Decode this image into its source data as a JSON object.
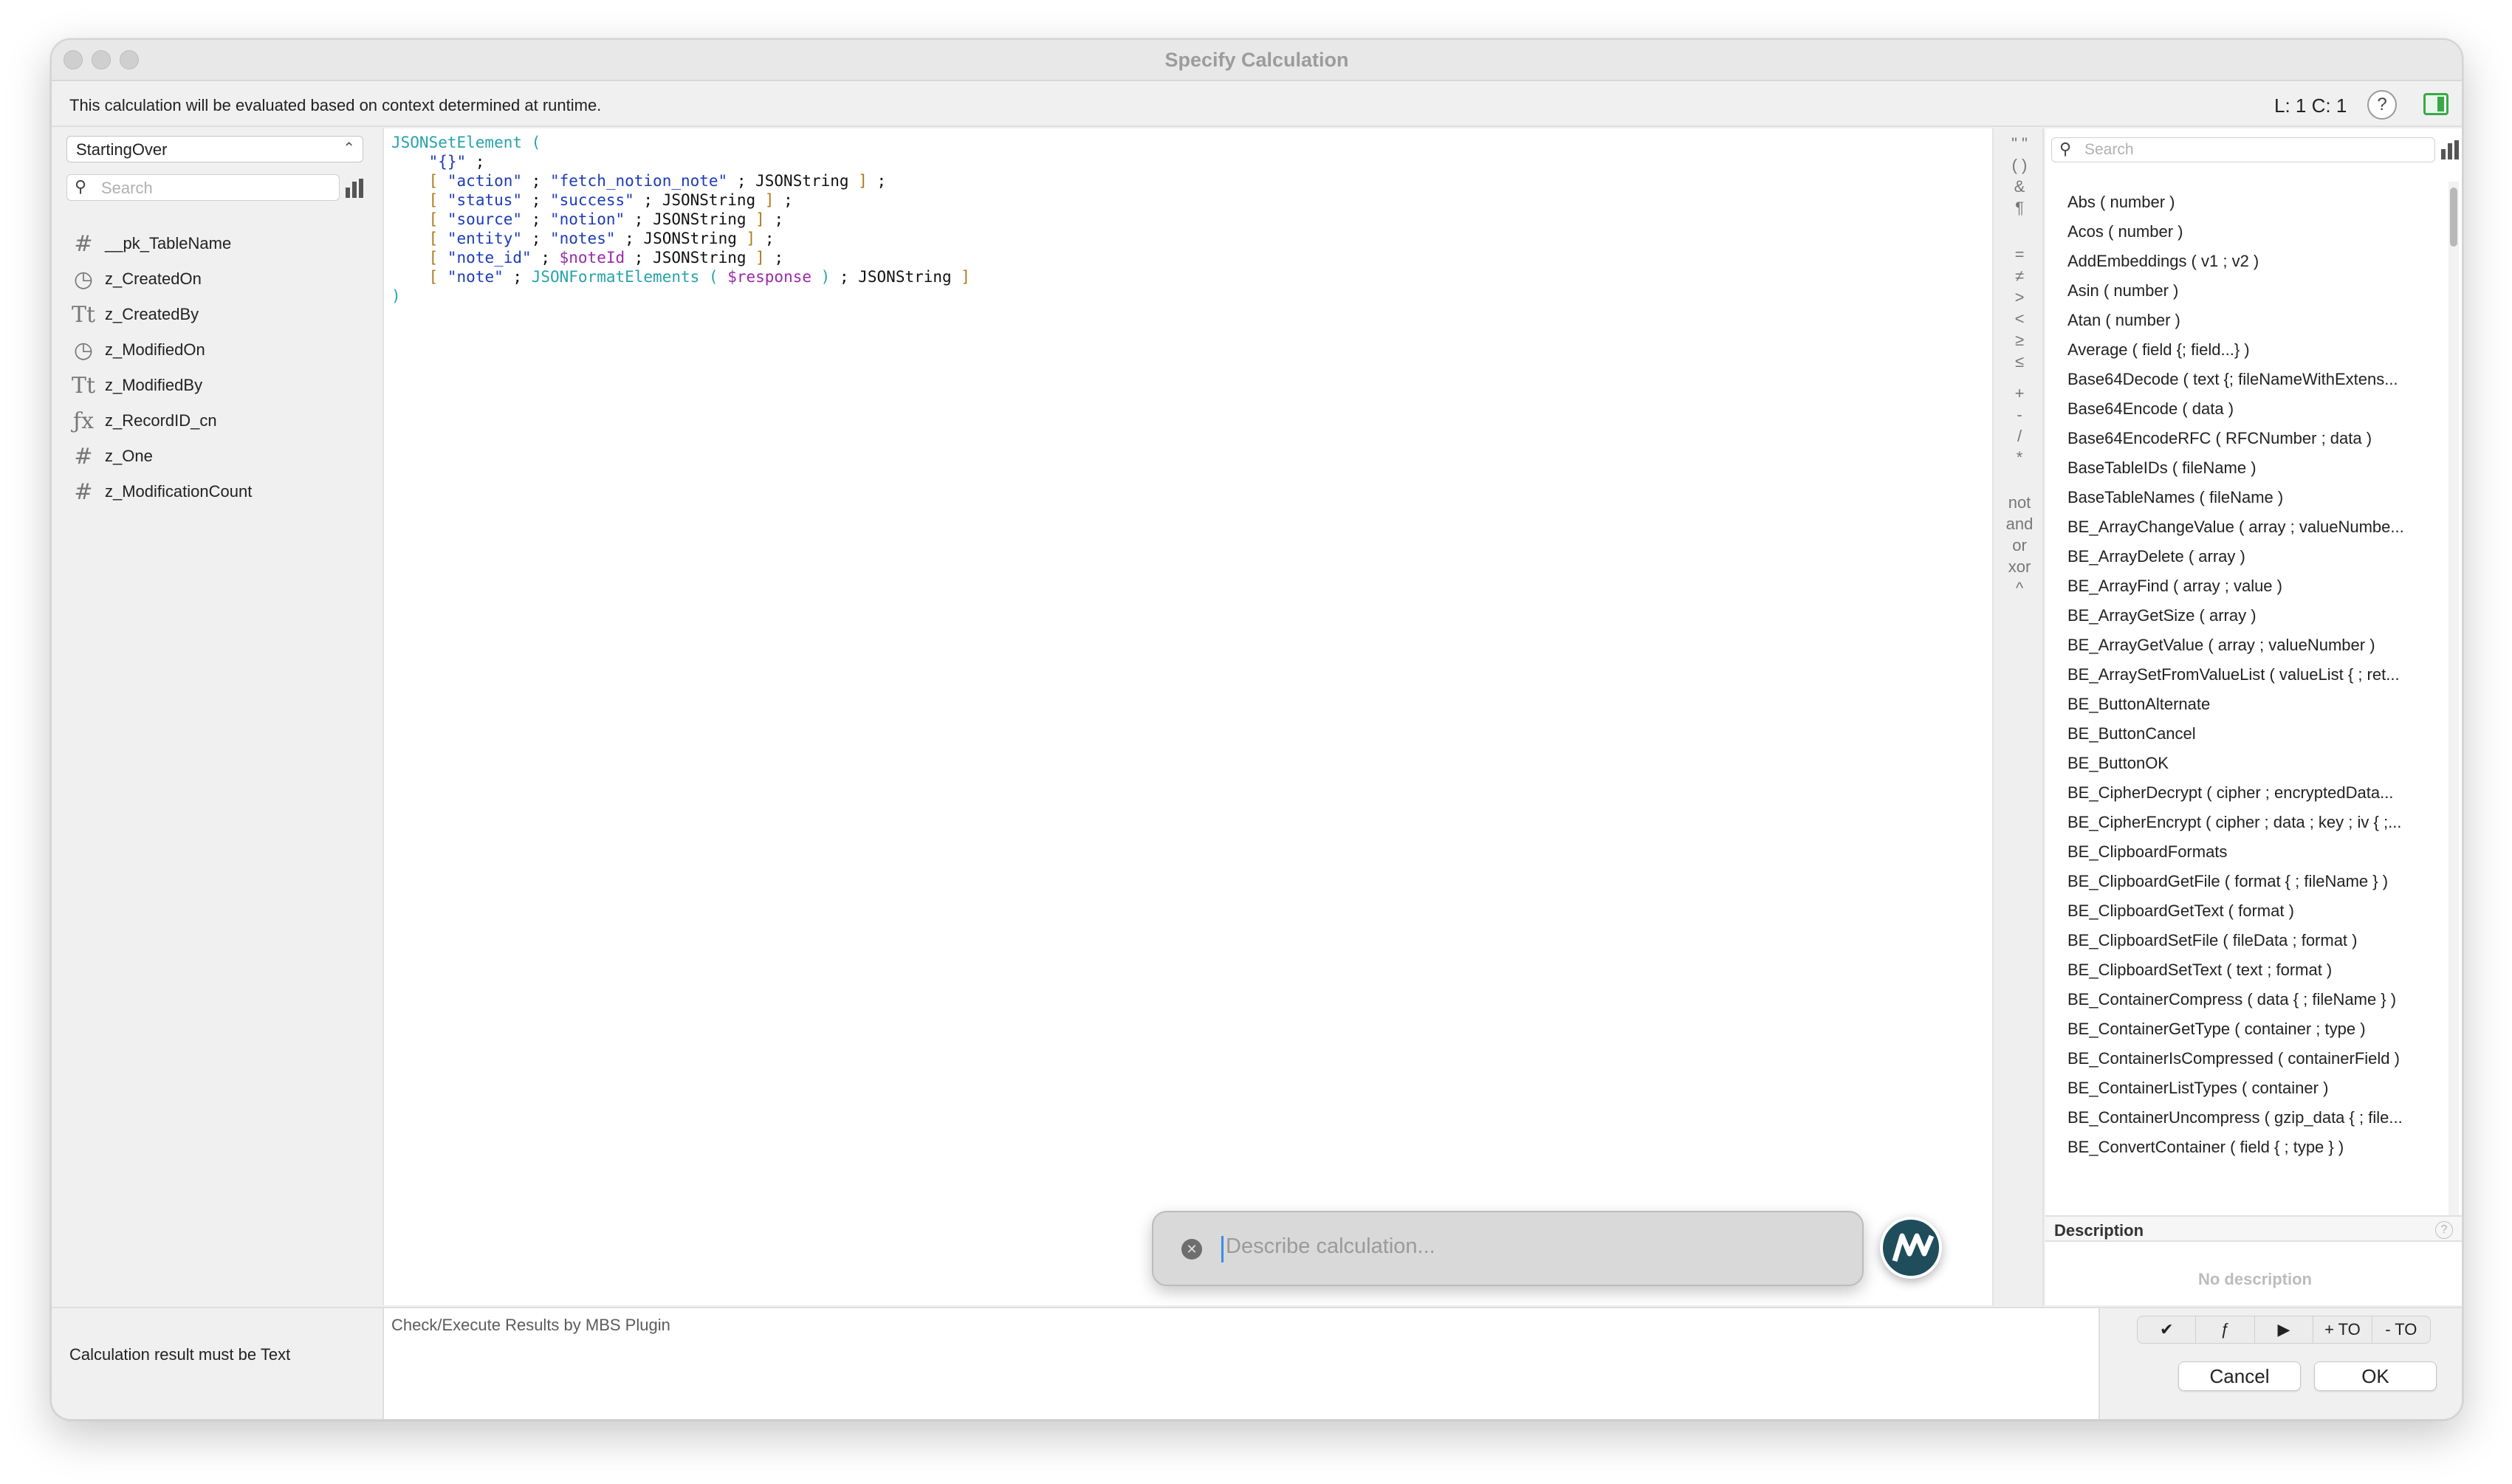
{
  "window": {
    "title": "Specify Calculation"
  },
  "infobar": {
    "context_text": "This calculation will be evaluated based on context determined at runtime.",
    "cursor_position": "L: 1 C: 1",
    "help_label": "?"
  },
  "fields_panel": {
    "table_selected": "StartingOver",
    "search_placeholder": "Search",
    "fields": [
      {
        "type_icon": "number-icon",
        "glyph": "#",
        "name": "__pk_TableName"
      },
      {
        "type_icon": "timestamp-icon",
        "glyph": "◷",
        "name": "z_CreatedOn"
      },
      {
        "type_icon": "text-icon",
        "glyph": "Tt",
        "name": "z_CreatedBy"
      },
      {
        "type_icon": "timestamp-icon",
        "glyph": "◷",
        "name": "z_ModifiedOn"
      },
      {
        "type_icon": "text-icon",
        "glyph": "Tt",
        "name": "z_ModifiedBy"
      },
      {
        "type_icon": "calculation-icon",
        "glyph": "ƒx",
        "name": "z_RecordID_cn"
      },
      {
        "type_icon": "number-icon",
        "glyph": "#",
        "name": "z_One"
      },
      {
        "type_icon": "number-icon",
        "glyph": "#",
        "name": "z_ModificationCount"
      }
    ]
  },
  "editor": {
    "code_lines": [
      [
        {
          "c": "fn",
          "t": "JSONSetElement ("
        }
      ],
      [
        {
          "c": "",
          "t": "    "
        },
        {
          "c": "str",
          "t": "\"{}\""
        },
        {
          "c": "",
          "t": " ;"
        }
      ],
      [
        {
          "c": "",
          "t": "    "
        },
        {
          "c": "br",
          "t": "["
        },
        {
          "c": "",
          "t": " "
        },
        {
          "c": "str",
          "t": "\"action\""
        },
        {
          "c": "",
          "t": " ; "
        },
        {
          "c": "str",
          "t": "\"fetch_notion_note\""
        },
        {
          "c": "",
          "t": " ; JSONString "
        },
        {
          "c": "br",
          "t": "]"
        },
        {
          "c": "",
          "t": " ;"
        }
      ],
      [
        {
          "c": "",
          "t": "    "
        },
        {
          "c": "br",
          "t": "["
        },
        {
          "c": "",
          "t": " "
        },
        {
          "c": "str",
          "t": "\"status\""
        },
        {
          "c": "",
          "t": " ; "
        },
        {
          "c": "str",
          "t": "\"success\""
        },
        {
          "c": "",
          "t": " ; JSONString "
        },
        {
          "c": "br",
          "t": "]"
        },
        {
          "c": "",
          "t": " ;"
        }
      ],
      [
        {
          "c": "",
          "t": "    "
        },
        {
          "c": "br",
          "t": "["
        },
        {
          "c": "",
          "t": " "
        },
        {
          "c": "str",
          "t": "\"source\""
        },
        {
          "c": "",
          "t": " ; "
        },
        {
          "c": "str",
          "t": "\"notion\""
        },
        {
          "c": "",
          "t": " ; JSONString "
        },
        {
          "c": "br",
          "t": "]"
        },
        {
          "c": "",
          "t": " ;"
        }
      ],
      [
        {
          "c": "",
          "t": "    "
        },
        {
          "c": "br",
          "t": "["
        },
        {
          "c": "",
          "t": " "
        },
        {
          "c": "str",
          "t": "\"entity\""
        },
        {
          "c": "",
          "t": " ; "
        },
        {
          "c": "str",
          "t": "\"notes\""
        },
        {
          "c": "",
          "t": " ; JSONString "
        },
        {
          "c": "br",
          "t": "]"
        },
        {
          "c": "",
          "t": " ;"
        }
      ],
      [
        {
          "c": "",
          "t": "    "
        },
        {
          "c": "br",
          "t": "["
        },
        {
          "c": "",
          "t": " "
        },
        {
          "c": "str",
          "t": "\"note_id\""
        },
        {
          "c": "",
          "t": " ; "
        },
        {
          "c": "var",
          "t": "$noteId"
        },
        {
          "c": "",
          "t": " ; JSONString "
        },
        {
          "c": "br",
          "t": "]"
        },
        {
          "c": "",
          "t": " ;"
        }
      ],
      [
        {
          "c": "",
          "t": "    "
        },
        {
          "c": "br",
          "t": "["
        },
        {
          "c": "",
          "t": " "
        },
        {
          "c": "str",
          "t": "\"note\""
        },
        {
          "c": "",
          "t": " ; "
        },
        {
          "c": "fn",
          "t": "JSONFormatElements ("
        },
        {
          "c": "",
          "t": " "
        },
        {
          "c": "var",
          "t": "$response"
        },
        {
          "c": "",
          "t": " "
        },
        {
          "c": "fn",
          "t": ")"
        },
        {
          "c": "",
          "t": " ; JSONString "
        },
        {
          "c": "br",
          "t": "]"
        }
      ],
      [
        {
          "c": "fn",
          "t": ")"
        }
      ]
    ]
  },
  "operators": {
    "group1": [
      "\" \"",
      "( )",
      "&",
      "¶"
    ],
    "group2": [
      "=",
      "≠",
      ">",
      "<",
      "≥",
      "≤"
    ],
    "group3": [
      "+",
      "-",
      "/",
      "*"
    ],
    "group4": [
      "not",
      "and",
      "or",
      "xor",
      "^"
    ]
  },
  "functions_panel": {
    "search_placeholder": "Search",
    "items": [
      "Abs ( number )",
      "Acos ( number )",
      "AddEmbeddings ( v1 ; v2 )",
      "Asin ( number )",
      "Atan ( number )",
      "Average ( field {; field...} )",
      "Base64Decode ( text {; fileNameWithExtens...",
      "Base64Encode ( data )",
      "Base64EncodeRFC ( RFCNumber ; data )",
      "BaseTableIDs ( fileName )",
      "BaseTableNames ( fileName )",
      "BE_ArrayChangeValue ( array ; valueNumbe...",
      "BE_ArrayDelete ( array )",
      "BE_ArrayFind ( array ; value )",
      "BE_ArrayGetSize ( array )",
      "BE_ArrayGetValue ( array ; valueNumber )",
      "BE_ArraySetFromValueList ( valueList { ; ret...",
      "BE_ButtonAlternate",
      "BE_ButtonCancel",
      "BE_ButtonOK",
      "BE_CipherDecrypt ( cipher ; encryptedData...",
      "BE_CipherEncrypt ( cipher ; data ; key ; iv { ;...",
      "BE_ClipboardFormats",
      "BE_ClipboardGetFile ( format { ; fileName } )",
      "BE_ClipboardGetText ( format )",
      "BE_ClipboardSetFile ( fileData ; format )",
      "BE_ClipboardSetText ( text ; format )",
      "BE_ContainerCompress ( data { ; fileName } )",
      "BE_ContainerGetType ( container ; type )",
      "BE_ContainerIsCompressed ( containerField )",
      "BE_ContainerListTypes ( container )",
      "BE_ContainerUncompress ( gzip_data { ; file...",
      "BE_ConvertContainer ( field { ; type } )"
    ],
    "description_title": "Description",
    "description_help": "?",
    "description_text": "No description"
  },
  "describe_popup": {
    "placeholder": "Describe calculation...",
    "clear_glyph": "✕"
  },
  "bottom": {
    "result_label": "Calculation result must be  Text",
    "results_text": "Check/Execute Results by MBS Plugin",
    "mbs_buttons": [
      "✔",
      "ƒ",
      "▶",
      "+ TO",
      "- TO"
    ],
    "cancel_label": "Cancel",
    "ok_label": "OK"
  },
  "colors": {
    "function": "#27a3a9",
    "string": "#1c3bb8",
    "bracket": "#b07a1a",
    "variable": "#9a2aa8",
    "panel_toggle": "#3aa84a",
    "plugin_logo": "#1f4d5c"
  }
}
